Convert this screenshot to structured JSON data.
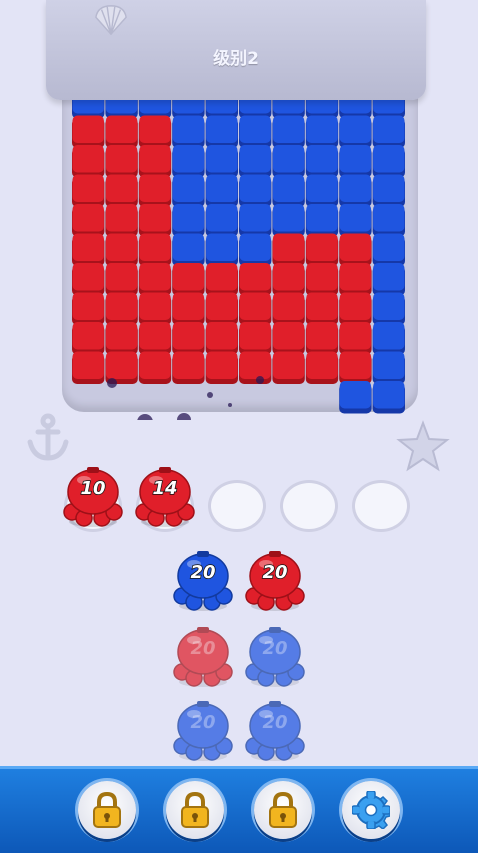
{
  "level": {
    "prefix": "级别",
    "number": "2"
  },
  "colors": {
    "red": "#e01f2a",
    "blue": "#1f55e0",
    "background": "#e3e4f6",
    "bar": "#1368cf"
  },
  "queue_slots": [
    {
      "filled": true,
      "color": "red",
      "count": "10"
    },
    {
      "filled": true,
      "color": "red",
      "count": "14"
    },
    {
      "filled": false
    },
    {
      "filled": false
    },
    {
      "filled": false
    }
  ],
  "octopus_rows": [
    [
      {
        "color": "blue",
        "count": "20",
        "locked": false
      },
      {
        "color": "red",
        "count": "20",
        "locked": false
      }
    ],
    [
      {
        "color": "red",
        "count": "20",
        "locked": true
      },
      {
        "color": "blue",
        "count": "20",
        "locked": true
      }
    ],
    [
      {
        "color": "blue",
        "count": "20",
        "locked": true
      },
      {
        "color": "blue",
        "count": "20",
        "locked": true
      }
    ]
  ],
  "bottom_buttons": [
    {
      "name": "lock-button-1",
      "icon": "lock-icon",
      "locked": true
    },
    {
      "name": "lock-button-2",
      "icon": "lock-icon",
      "locked": true
    },
    {
      "name": "lock-button-3",
      "icon": "lock-icon",
      "locked": true
    },
    {
      "name": "settings-button",
      "icon": "gear-icon",
      "locked": false
    }
  ],
  "decorations": [
    "shell-icon",
    "anchor-icon",
    "starfish-icon"
  ]
}
